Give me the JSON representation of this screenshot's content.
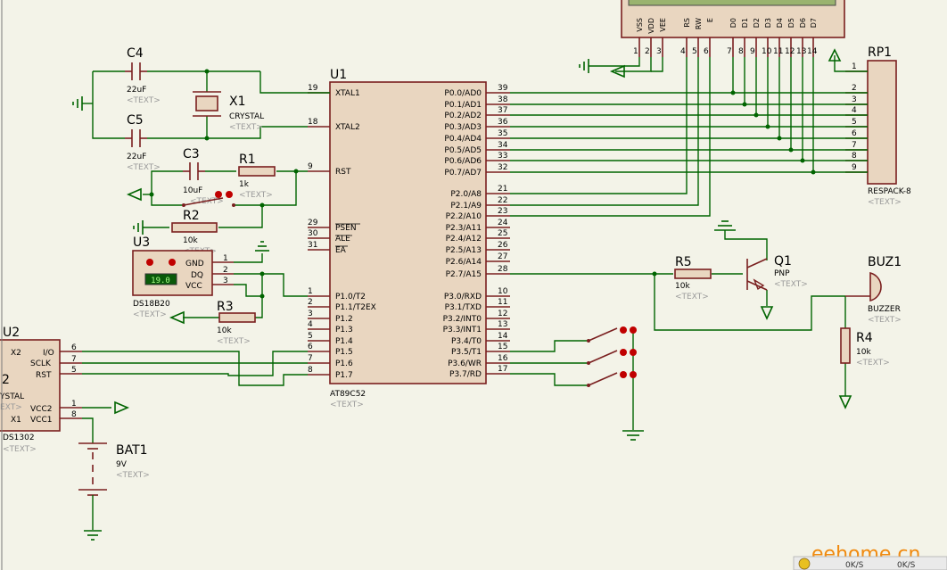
{
  "lcd": {
    "pins": [
      "VSS",
      "VDD",
      "VEE",
      "RS",
      "RW",
      "E",
      "D0",
      "D1",
      "D2",
      "D3",
      "D4",
      "D5",
      "D6",
      "D7"
    ],
    "pin_numbers": [
      "1",
      "2",
      "3",
      "4",
      "5",
      "6",
      "7",
      "8",
      "9",
      "10",
      "11",
      "12",
      "13",
      "14"
    ]
  },
  "u1": {
    "ref": "U1",
    "value": "AT89C52",
    "text": "<TEXT>",
    "left_pins": [
      {
        "num": "19",
        "name": "XTAL1"
      },
      {
        "num": "18",
        "name": "XTAL2"
      },
      {
        "num": "9",
        "name": "RST"
      },
      {
        "num": "29",
        "name": "PSEN"
      },
      {
        "num": "30",
        "name": "ALE"
      },
      {
        "num": "31",
        "name": "EA"
      },
      {
        "num": "1",
        "name": "P1.0/T2"
      },
      {
        "num": "2",
        "name": "P1.1/T2EX"
      },
      {
        "num": "3",
        "name": "P1.2"
      },
      {
        "num": "4",
        "name": "P1.3"
      },
      {
        "num": "5",
        "name": "P1.4"
      },
      {
        "num": "6",
        "name": "P1.5"
      },
      {
        "num": "7",
        "name": "P1.6"
      },
      {
        "num": "8",
        "name": "P1.7"
      }
    ],
    "right_pins": [
      {
        "num": "39",
        "name": "P0.0/AD0"
      },
      {
        "num": "38",
        "name": "P0.1/AD1"
      },
      {
        "num": "37",
        "name": "P0.2/AD2"
      },
      {
        "num": "36",
        "name": "P0.3/AD3"
      },
      {
        "num": "35",
        "name": "P0.4/AD4"
      },
      {
        "num": "34",
        "name": "P0.5/AD5"
      },
      {
        "num": "33",
        "name": "P0.6/AD6"
      },
      {
        "num": "32",
        "name": "P0.7/AD7"
      },
      {
        "num": "21",
        "name": "P2.0/A8"
      },
      {
        "num": "22",
        "name": "P2.1/A9"
      },
      {
        "num": "23",
        "name": "P2.2/A10"
      },
      {
        "num": "24",
        "name": "P2.3/A11"
      },
      {
        "num": "25",
        "name": "P2.4/A12"
      },
      {
        "num": "26",
        "name": "P2.5/A13"
      },
      {
        "num": "27",
        "name": "P2.6/A14"
      },
      {
        "num": "28",
        "name": "P2.7/A15"
      },
      {
        "num": "10",
        "name": "P3.0/RXD"
      },
      {
        "num": "11",
        "name": "P3.1/TXD"
      },
      {
        "num": "12",
        "name": "P3.2/INT0"
      },
      {
        "num": "13",
        "name": "P3.3/INT1"
      },
      {
        "num": "14",
        "name": "P3.4/T0"
      },
      {
        "num": "15",
        "name": "P3.5/T1"
      },
      {
        "num": "16",
        "name": "P3.6/WR"
      },
      {
        "num": "17",
        "name": "P3.7/RD"
      }
    ]
  },
  "rp1": {
    "ref": "RP1",
    "value": "RESPACK-8",
    "text": "<TEXT>",
    "pins": [
      "1",
      "2",
      "3",
      "4",
      "5",
      "6",
      "7",
      "8",
      "9"
    ]
  },
  "c4": {
    "ref": "C4",
    "value": "22uF",
    "text": "<TEXT>"
  },
  "c5": {
    "ref": "C5",
    "value": "22uF",
    "text": "<TEXT>"
  },
  "c3": {
    "ref": "C3",
    "value": "10uF",
    "text": "<TEXT>"
  },
  "x1": {
    "ref": "X1",
    "value": "CRYSTAL",
    "text": "<TEXT>"
  },
  "r1": {
    "ref": "R1",
    "value": "1k",
    "text": "<TEXT>"
  },
  "r2": {
    "ref": "R2",
    "value": "10k",
    "text": "<TEXT>"
  },
  "r3": {
    "ref": "R3",
    "value": "10k",
    "text": "<TEXT>"
  },
  "r4": {
    "ref": "R4",
    "value": "10k",
    "text": "<TEXT>"
  },
  "r5": {
    "ref": "R5",
    "value": "10k",
    "text": "<TEXT>"
  },
  "u3": {
    "ref": "U3",
    "value": "DS18B20",
    "text": "<TEXT>",
    "reading": "19.0",
    "pins": [
      {
        "num": "1",
        "name": "GND"
      },
      {
        "num": "2",
        "name": "DQ"
      },
      {
        "num": "3",
        "name": "VCC"
      }
    ]
  },
  "u2": {
    "ref": "U2",
    "value": "DS1302",
    "text": "<TEXT>",
    "left_labels": [
      "X2",
      "2",
      "YSTAL",
      "X1"
    ],
    "left_text": "EXT>",
    "pins": [
      {
        "num": "6",
        "name": "I/O"
      },
      {
        "num": "7",
        "name": "SCLK"
      },
      {
        "num": "5",
        "name": "RST"
      },
      {
        "num": "1",
        "name": "VCC2"
      },
      {
        "num": "8",
        "name": "VCC1"
      }
    ]
  },
  "q1": {
    "ref": "Q1",
    "value": "PNP",
    "text": "<TEXT>"
  },
  "buz1": {
    "ref": "BUZ1",
    "value": "BUZZER",
    "text": "<TEXT>"
  },
  "bat1": {
    "ref": "BAT1",
    "value": "9V",
    "text": "<TEXT>"
  },
  "watermark": "eehome.cn",
  "tray": {
    "item1": "0K/S",
    "item2": "0K/S"
  }
}
